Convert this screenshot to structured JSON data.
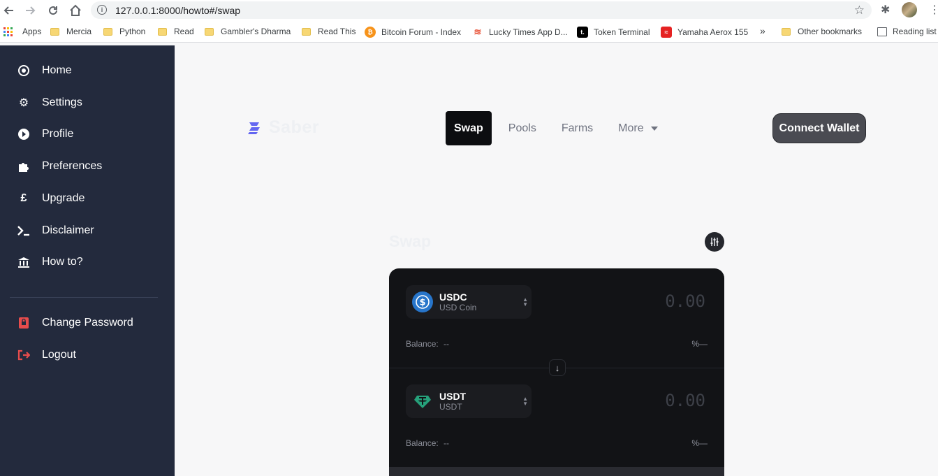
{
  "browser": {
    "url": "127.0.0.1:8000/howto#/swap",
    "bookmarks": [
      {
        "label": "Apps"
      },
      {
        "label": "Mercia"
      },
      {
        "label": "Python"
      },
      {
        "label": "Read"
      },
      {
        "label": "Gambler's Dharma"
      },
      {
        "label": "Read This"
      },
      {
        "label": "Bitcoin Forum - Index"
      },
      {
        "label": "Lucky Times App D..."
      },
      {
        "label": "Token Terminal"
      },
      {
        "label": "Yamaha Aerox 155"
      },
      {
        "label": "»"
      },
      {
        "label": "Other bookmarks"
      },
      {
        "label": "Reading list"
      }
    ]
  },
  "sidebar": {
    "items": [
      {
        "label": "Home",
        "icon": "target-icon"
      },
      {
        "label": "Settings",
        "icon": "gear-icon"
      },
      {
        "label": "Profile",
        "icon": "play-circle-icon"
      },
      {
        "label": "Preferences",
        "icon": "puzzle-icon"
      },
      {
        "label": "Upgrade",
        "icon": "pound-icon"
      },
      {
        "label": "Disclaimer",
        "icon": "terminal-icon"
      },
      {
        "label": "How to?",
        "icon": "bank-icon"
      }
    ],
    "account": [
      {
        "label": "Change Password",
        "icon": "lock-book-icon"
      },
      {
        "label": "Logout",
        "icon": "logout-icon"
      }
    ]
  },
  "header": {
    "logo": "Saber",
    "tabs": [
      {
        "label": "Swap"
      },
      {
        "label": "Pools"
      },
      {
        "label": "Farms"
      },
      {
        "label": "More"
      }
    ],
    "connect_label": "Connect Wallet"
  },
  "swap": {
    "title": "Swap",
    "from": {
      "symbol": "USDC",
      "name": "USD Coin",
      "amount": "0.00",
      "balance_label": "Balance:",
      "balance": "--",
      "pct": "%—"
    },
    "to": {
      "symbol": "USDT",
      "name": "USDT",
      "amount": "0.00",
      "balance_label": "Balance:",
      "balance": "--",
      "pct": "%—"
    }
  },
  "colors": {
    "sidebar_bg": "#232a3d",
    "accent": "#6366f1",
    "card_bg": "#121316",
    "usdc": "#2775ca",
    "usdt": "#26a17b",
    "logout_red": "#e74c4c"
  }
}
